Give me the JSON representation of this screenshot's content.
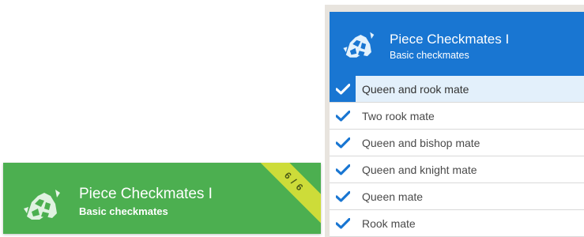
{
  "colors": {
    "card_green": "#4caf50",
    "ribbon_lime": "#cddc39",
    "header_blue": "#1976d2",
    "check_blue": "#1976d2",
    "active_row": "#e3f0fb"
  },
  "card": {
    "icon": "chess-pieces-icon",
    "title": "Piece Checkmates I",
    "subtitle": "Basic checkmates",
    "progress_label": "6 / 6",
    "completed": 6,
    "total": 6
  },
  "panel": {
    "icon": "chess-pieces-icon",
    "title": "Piece Checkmates I",
    "subtitle": "Basic checkmates",
    "chapters": [
      {
        "label": "Queen and rook mate",
        "done": true,
        "active": true
      },
      {
        "label": "Two rook mate",
        "done": true,
        "active": false
      },
      {
        "label": "Queen and bishop mate",
        "done": true,
        "active": false
      },
      {
        "label": "Queen and knight mate",
        "done": true,
        "active": false
      },
      {
        "label": "Queen mate",
        "done": true,
        "active": false
      },
      {
        "label": "Rook mate",
        "done": true,
        "active": false
      }
    ]
  }
}
